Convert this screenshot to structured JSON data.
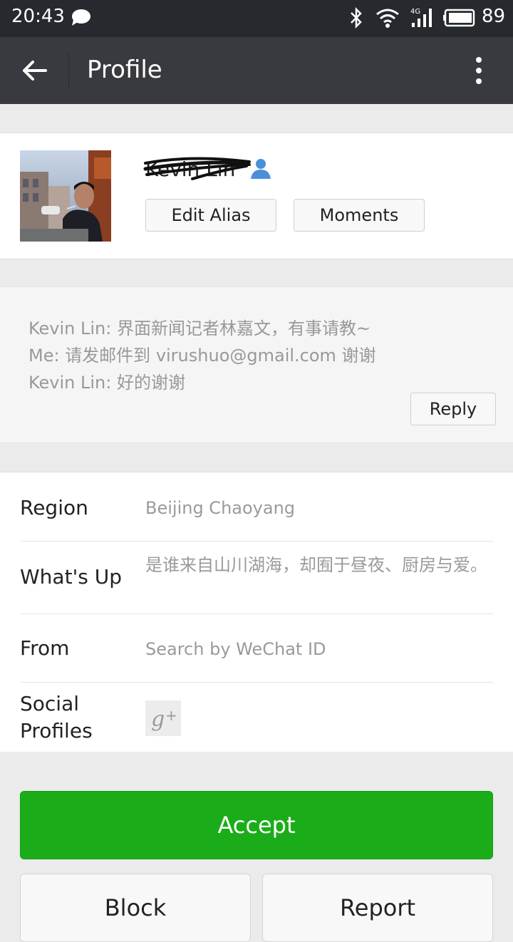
{
  "status_bar": {
    "time": "20:43",
    "battery": "89",
    "icons": [
      "chat-bubble-icon",
      "bluetooth-icon",
      "wifi-icon",
      "signal-4g-icon",
      "battery-icon"
    ]
  },
  "app_bar": {
    "title": "Profile",
    "back_icon": "back-arrow-icon",
    "menu_icon": "more-vertical-icon"
  },
  "profile": {
    "name": "Kevin Lin",
    "name_redacted": true,
    "buttons": {
      "edit_alias": "Edit Alias",
      "moments": "Moments"
    }
  },
  "messages": {
    "lines": [
      "Kevin Lin: 界面新闻记者林嘉文，有事请教~",
      "Me: 请发邮件到 virushuo@gmail.com 谢谢",
      "Kevin Lin: 好的谢谢"
    ],
    "reply_label": "Reply"
  },
  "info": {
    "region": {
      "label": "Region",
      "value": "Beijing  Chaoyang"
    },
    "whats_up": {
      "label": "What's Up",
      "value": "是谁来自山川湖海，却囿于昼夜、厨房与爱。"
    },
    "from": {
      "label": "From",
      "value": "Search by WeChat ID"
    },
    "social": {
      "label": "Social Profiles",
      "icon": "google-plus-icon"
    }
  },
  "actions": {
    "accept": "Accept",
    "block": "Block",
    "report": "Report"
  },
  "colors": {
    "accept": "#1aad19",
    "app_bar": "#393a3f",
    "status_bar": "#26292d"
  }
}
